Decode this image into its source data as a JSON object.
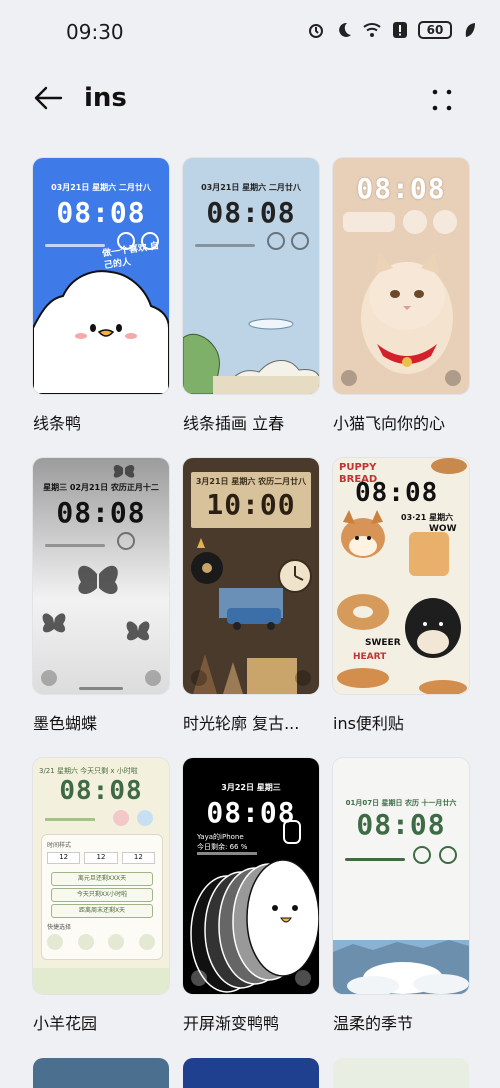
{
  "status": {
    "time": "09:30",
    "battery": "60"
  },
  "header": {
    "title": "ins"
  },
  "tiles": [
    {
      "label": "线条鸭",
      "date": "03月21日 星期六 二月廿八",
      "time": "08:08",
      "caption": "做一个喜欢 自己的人"
    },
    {
      "label": "线条插画 立春",
      "date": "03月21日 星期六 二月廿八",
      "time": "08:08"
    },
    {
      "label": "小猫飞向你的心",
      "time": "08:08"
    },
    {
      "label": "墨色蝴蝶",
      "date": "星期三 02月21日 农历正月十二",
      "time": "08:08"
    },
    {
      "label": "时光轮廓 复古...",
      "date": "3月21日 星期六 农历二月廿八",
      "time": "10:00"
    },
    {
      "label": "ins便利贴",
      "time": "08:08",
      "date": "03·21 星期六",
      "sticker_top": "PUPPY",
      "sticker_mid": "BREAD",
      "wow": "WOW",
      "sweer": "SWEER",
      "heart": "HEART"
    },
    {
      "label": "小羊花园",
      "date": "3/21 星期六 今天只剩 x 小时啦",
      "time": "08:08",
      "buttons": [
        "离元旦还剩XXX天",
        "今天只剩XX小时啦",
        "距离周末还剩X天"
      ],
      "shortcuts_label": "快捷选择",
      "time_style_label": "时间样式"
    },
    {
      "label": "开屏渐变鸭鸭",
      "date": "3月22日 星期三",
      "time": "08:08",
      "device": "Yaya的iPhone",
      "percent": "今日剩余: 66 %"
    },
    {
      "label": "温柔的季节",
      "date": "01月07日 星期日 农历 十一月廿六",
      "time": "08:08"
    }
  ],
  "colors": {
    "background": "#eef0f3",
    "duck_blue": "#3f7be8",
    "illustration_blue": "#bcd4e6",
    "cat_beige": "#e8cfb7",
    "butterfly_gray": "#d9d9d9",
    "retro_brown": "#4a3a2b",
    "sticker_cream": "#f4efe3",
    "garden_cream": "#f3f1de",
    "duck_black": "#000000",
    "season_green": "#3e6b45"
  }
}
